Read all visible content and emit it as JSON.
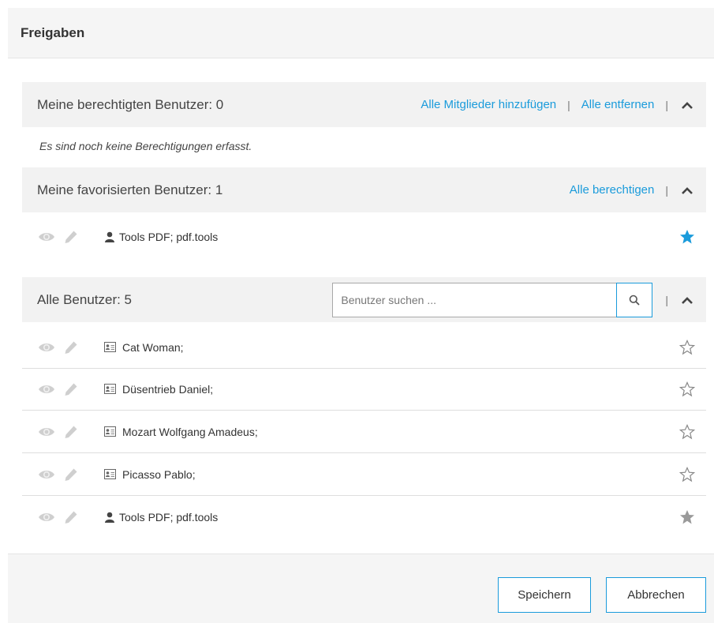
{
  "dialog": {
    "title": "Freigaben"
  },
  "authorized": {
    "title": "Meine berechtigten Benutzer: 0",
    "add_all_label": "Alle Mitglieder hinzufügen",
    "separator": "|",
    "remove_all_label": "Alle entfernen",
    "empty_message": "Es sind noch keine Berechtigungen erfasst."
  },
  "favorites": {
    "title": "Meine favorisierten Benutzer: 1",
    "authorize_all_label": "Alle berechtigen",
    "separator": "|",
    "users": [
      {
        "name": "Tools PDF; pdf.tools",
        "type": "user-icon",
        "star": "filled-blue"
      }
    ]
  },
  "all_users": {
    "title": "Alle Benutzer: 5",
    "search_placeholder": "Benutzer suchen ...",
    "separator": "|",
    "users": [
      {
        "name": "Cat Woman;",
        "type": "contact-card-icon",
        "star": "outline"
      },
      {
        "name": "Düsentrieb Daniel;",
        "type": "contact-card-icon",
        "star": "outline"
      },
      {
        "name": "Mozart Wolfgang Amadeus;",
        "type": "contact-card-icon",
        "star": "outline"
      },
      {
        "name": "Picasso Pablo;",
        "type": "contact-card-icon",
        "star": "outline"
      },
      {
        "name": "Tools PDF; pdf.tools",
        "type": "user-icon",
        "star": "filled-gray"
      }
    ]
  },
  "footer": {
    "save_label": "Speichern",
    "cancel_label": "Abbrechen"
  },
  "colors": {
    "accent": "#1a9bdb",
    "section_bg": "#f2f2f2",
    "icon_gray": "#c8c8c8"
  }
}
